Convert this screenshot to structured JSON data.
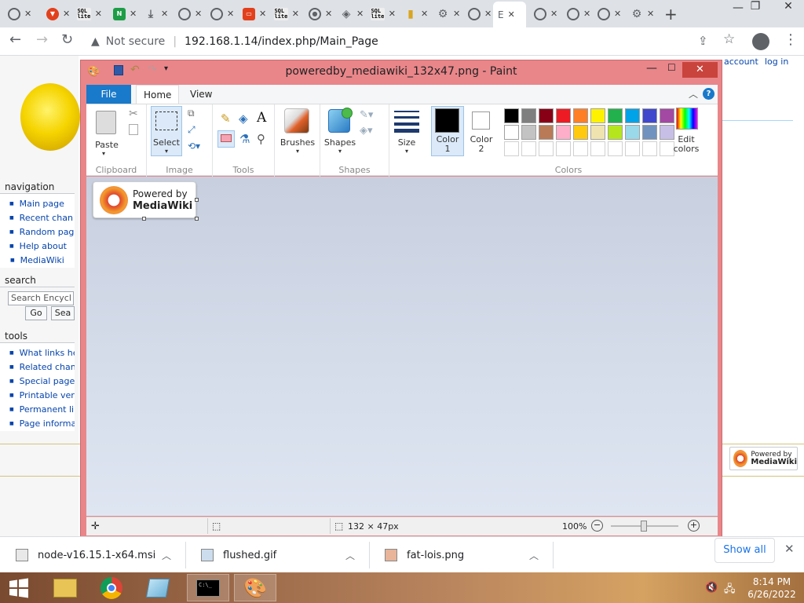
{
  "browser": {
    "tabs": [
      {
        "icon": "globe-icon"
      },
      {
        "icon": "brave-icon"
      },
      {
        "icon": "sql-icon"
      },
      {
        "icon": "nginx-icon"
      },
      {
        "icon": "download-icon"
      },
      {
        "icon": "globe-icon"
      },
      {
        "icon": "globe-icon"
      },
      {
        "icon": "app-icon"
      },
      {
        "icon": "sql-icon"
      },
      {
        "icon": "chrome-icon"
      },
      {
        "icon": "diamond-icon"
      },
      {
        "icon": "sql-icon"
      },
      {
        "icon": "folder-icon"
      },
      {
        "icon": "gear-icon"
      },
      {
        "icon": "globe-icon"
      },
      {
        "icon": "active-tab",
        "label": "E"
      },
      {
        "icon": "globe-icon"
      },
      {
        "icon": "globe-icon"
      },
      {
        "icon": "globe-icon"
      },
      {
        "icon": "gear-icon"
      }
    ],
    "address": {
      "security": "Not secure",
      "url": "192.168.1.14/index.php/Main_Page"
    }
  },
  "wiki": {
    "personal": {
      "account": "account",
      "login": "log in"
    },
    "navigation": {
      "heading": "navigation",
      "items": [
        "Main page",
        "Recent chan",
        "Random pag",
        "Help about",
        "MediaWiki"
      ]
    },
    "search": {
      "heading": "search",
      "placeholder": "Search Encycl",
      "go": "Go",
      "search": "Sea"
    },
    "tools": {
      "heading": "tools",
      "items": [
        "What links he",
        "Related chan",
        "Special page",
        "Printable ver",
        "Permanent li",
        "Page informa"
      ]
    },
    "footer_badge": {
      "line1": "Powered by",
      "line2": "MediaWiki"
    }
  },
  "paint": {
    "title": "poweredby_mediawiki_132x47.png - Paint",
    "tabs": {
      "file": "File",
      "home": "Home",
      "view": "View"
    },
    "groups": {
      "clipboard": "Clipboard",
      "image": "Image",
      "tools": "Tools",
      "shapes": "Shapes",
      "colors": "Colors"
    },
    "buttons": {
      "paste": "Paste",
      "select": "Select",
      "brushes": "Brushes",
      "shapes": "Shapes",
      "size": "Size",
      "color1_a": "Color",
      "color1_b": "1",
      "color2_a": "Color",
      "color2_b": "2",
      "edit_colors_a": "Edit",
      "edit_colors_b": "colors"
    },
    "color1": "#000000",
    "color2": "#ffffff",
    "palette_row1": [
      "#000000",
      "#7f7f7f",
      "#880015",
      "#ed1c24",
      "#ff7f27",
      "#fff200",
      "#22b14c",
      "#00a2e8",
      "#3f48cc",
      "#a349a4"
    ],
    "palette_row2": [
      "#ffffff",
      "#c3c3c3",
      "#b97a57",
      "#ffaec9",
      "#ffc90e",
      "#efe4b0",
      "#b5e61d",
      "#99d9ea",
      "#7092be",
      "#c8bfe7"
    ],
    "image_text": {
      "line1": "Powered by",
      "line2": "MediaWiki"
    },
    "status": {
      "dimensions": "132 × 47px",
      "zoom": "100%"
    }
  },
  "downloads": {
    "items": [
      {
        "name": "node-v16.15.1-x64.msi"
      },
      {
        "name": "flushed.gif"
      },
      {
        "name": "fat-lois.png"
      }
    ],
    "show_all": "Show all"
  },
  "taskbar": {
    "time": "8:14 PM",
    "date": "6/26/2022"
  }
}
